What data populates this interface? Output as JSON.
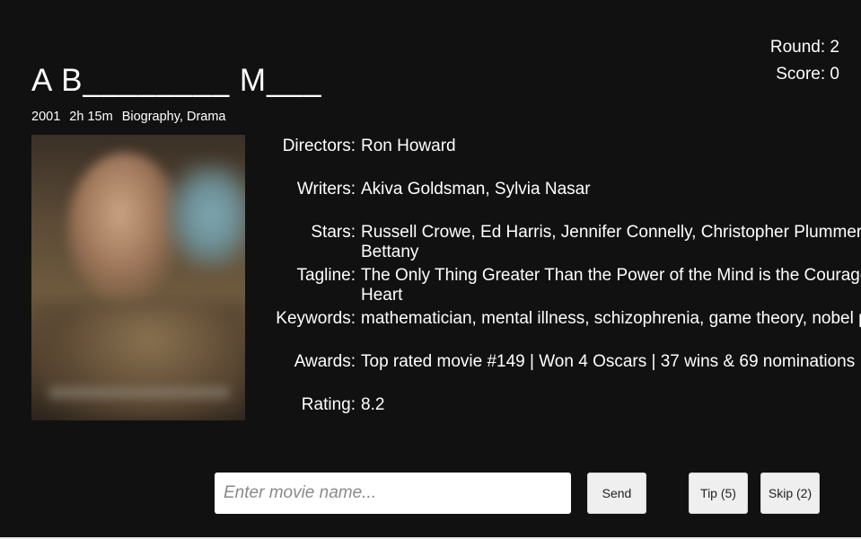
{
  "status": {
    "round": "Round: 2",
    "score": "Score: 0"
  },
  "movie": {
    "masked_title": "A B________ M___",
    "year": "2001",
    "duration": "2h 15m",
    "genres": "Biography, Drama"
  },
  "details": [
    {
      "label": "Directors:",
      "value": "Ron Howard",
      "value2": ""
    },
    {
      "label": "Writers:",
      "value": "Akiva Goldsman, Sylvia Nasar",
      "value2": ""
    },
    {
      "label": "Stars:",
      "value": "Russell Crowe, Ed Harris, Jennifer Connelly, Christopher Plummer, Paul",
      "value2": "Bettany"
    },
    {
      "label": "Tagline:",
      "value": "The Only Thing Greater Than the Power of the Mind is the Courage of the",
      "value2": "Heart"
    },
    {
      "label": "Keywords:",
      "value": "mathematician, mental illness, schizophrenia, game theory, nobel prize",
      "value2": ""
    },
    {
      "label": "Awards:",
      "value": "Top rated movie #149 | Won 4 Oscars | 37 wins & 69 nominations",
      "value2": ""
    },
    {
      "label": "Rating:",
      "value": "8.2",
      "value2": ""
    }
  ],
  "guess": {
    "placeholder": "Enter movie name..."
  },
  "buttons": {
    "send": "Send",
    "tip": "Tip (5)",
    "skip": "Skip (2)"
  }
}
